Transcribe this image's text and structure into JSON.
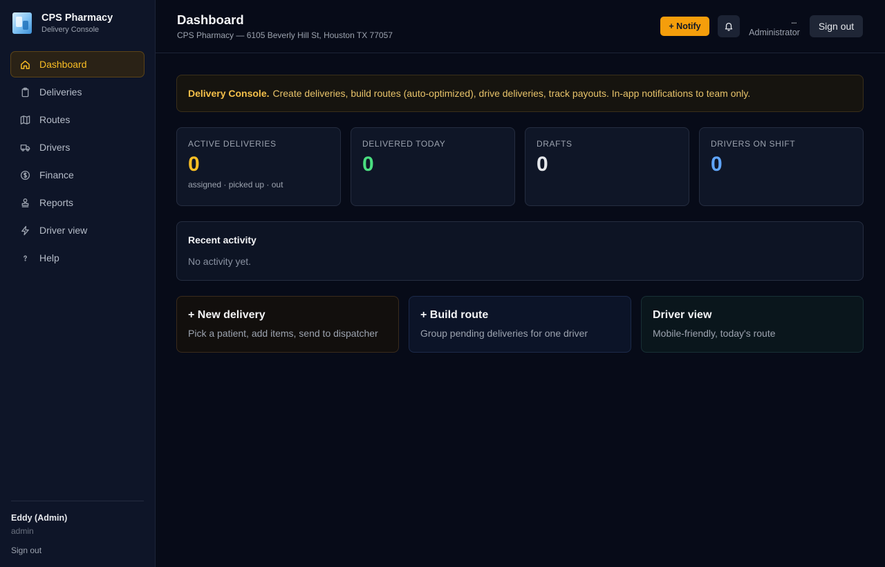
{
  "brand": {
    "name": "CPS Pharmacy",
    "subtitle": "Delivery Console"
  },
  "sidebar": {
    "items": [
      {
        "label": "Dashboard",
        "icon": "home-icon",
        "active": true
      },
      {
        "label": "Deliveries",
        "icon": "clipboard-icon"
      },
      {
        "label": "Routes",
        "icon": "map-icon"
      },
      {
        "label": "Drivers",
        "icon": "truck-icon"
      },
      {
        "label": "Finance",
        "icon": "dollar-icon"
      },
      {
        "label": "Reports",
        "icon": "stamp-icon"
      },
      {
        "label": "Driver view",
        "icon": "bolt-icon"
      },
      {
        "label": "Help",
        "icon": "question-icon"
      }
    ],
    "user": {
      "name": "Eddy (Admin)",
      "role": "admin",
      "signout": "Sign out"
    }
  },
  "header": {
    "title": "Dashboard",
    "subtitle": "CPS Pharmacy — 6105 Beverly Hill St, Houston TX 77057",
    "notify_label": "+ Notify",
    "admin_dots": "...",
    "admin_label": "Administrator",
    "signout_label": "Sign out"
  },
  "banner": {
    "bold": "Delivery Console.",
    "text": "Create deliveries, build routes (auto-optimized), drive deliveries, track payouts. In-app notifications to team only."
  },
  "stats": [
    {
      "label": "ACTIVE DELIVERIES",
      "value": "0",
      "foot": "assigned · picked up · out",
      "color": "#fbbf24"
    },
    {
      "label": "DELIVERED TODAY",
      "value": "0",
      "foot": "",
      "color": "#4ade80"
    },
    {
      "label": "DRAFTS",
      "value": "0",
      "foot": "",
      "color": "#e5e7eb"
    },
    {
      "label": "DRIVERS ON SHIFT",
      "value": "0",
      "foot": "",
      "color": "#60a5fa"
    }
  ],
  "activity": {
    "title": "Recent activity",
    "empty": "No activity yet."
  },
  "actions": [
    {
      "title": "+ New delivery",
      "subtitle": "Pick a patient, add items, send to dispatcher"
    },
    {
      "title": "+ Build route",
      "subtitle": "Group pending deliveries for one driver"
    },
    {
      "title": "Driver view",
      "subtitle": "Mobile-friendly, today's route"
    }
  ]
}
